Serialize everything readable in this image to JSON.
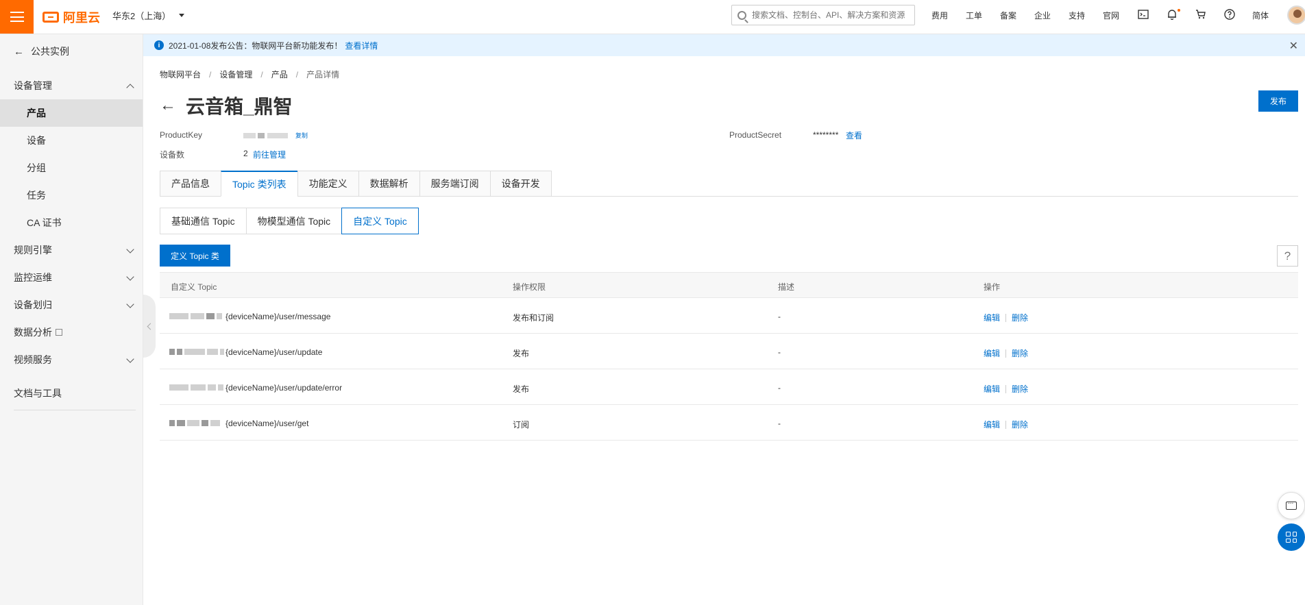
{
  "topbar": {
    "logo_text": "阿里云",
    "region": "华东2（上海）",
    "search_placeholder": "搜索文档、控制台、API、解决方案和资源",
    "links": [
      "费用",
      "工单",
      "备案",
      "企业",
      "支持",
      "官网"
    ],
    "lang": "简体",
    "colors": {
      "brand": "#ff6a00",
      "accent": "#0070cc"
    }
  },
  "sidebar": {
    "back_label": "公共实例",
    "groups": [
      {
        "label": "设备管理",
        "expanded": true
      },
      {
        "label": "规则引擎",
        "expanded": false
      },
      {
        "label": "监控运维",
        "expanded": false
      },
      {
        "label": "设备划归",
        "expanded": false
      },
      {
        "label": "数据分析",
        "external": true
      },
      {
        "label": "视频服务",
        "expanded": false
      }
    ],
    "subitems": [
      "产品",
      "设备",
      "分组",
      "任务",
      "CA 证书"
    ],
    "active_subitem": "产品",
    "footer_item": "文档与工具"
  },
  "notice": {
    "text": "2021-01-08发布公告：物联网平台新功能发布！",
    "link": "查看详情"
  },
  "breadcrumb": [
    "物联网平台",
    "设备管理",
    "产品",
    "产品详情"
  ],
  "page": {
    "title": "云音箱_鼎智",
    "publish_label": "发布",
    "productkey_label": "ProductKey",
    "copy_label": "复制",
    "productsecret_label": "ProductSecret",
    "productsecret_value": "********",
    "view_label": "查看",
    "device_count_label": "设备数",
    "device_count_value": "2",
    "manage_link": "前往管理"
  },
  "tabs": [
    "产品信息",
    "Topic 类列表",
    "功能定义",
    "数据解析",
    "服务端订阅",
    "设备开发"
  ],
  "active_tab": "Topic 类列表",
  "subtabs": [
    "基础通信 Topic",
    "物模型通信 Topic",
    "自定义 Topic"
  ],
  "active_subtab": "自定义 Topic",
  "define_button": "定义 Topic 类",
  "help_label": "?",
  "table": {
    "headers": [
      "自定义 Topic",
      "操作权限",
      "描述",
      "操作"
    ],
    "rows": [
      {
        "topic_suffix": "{deviceName}/user/message",
        "permission": "发布和订阅",
        "desc": "-",
        "edit": "编辑",
        "delete": "删除"
      },
      {
        "topic_suffix": "{deviceName}/user/update",
        "permission": "发布",
        "desc": "-",
        "edit": "编辑",
        "delete": "删除"
      },
      {
        "topic_suffix": "{deviceName}/user/update/error",
        "permission": "发布",
        "desc": "-",
        "edit": "编辑",
        "delete": "删除"
      },
      {
        "topic_suffix": "{deviceName}/user/get",
        "permission": "订阅",
        "desc": "-",
        "edit": "编辑",
        "delete": "删除"
      }
    ]
  }
}
